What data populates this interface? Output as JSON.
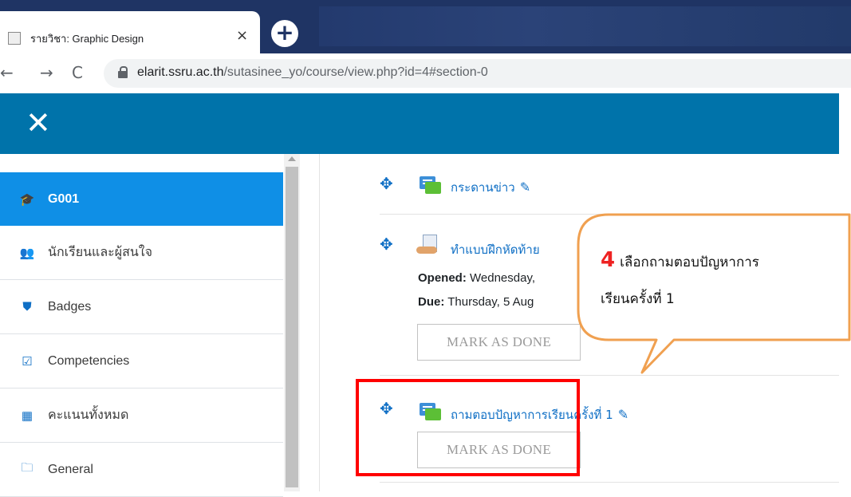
{
  "browser": {
    "tab_title": "รายวิชา: Graphic Design",
    "tab_close": "×",
    "new_tab": "+",
    "url_host": "elarit.ssru.ac.th",
    "url_path": "/sutasinee_yo/course/view.php?id=4#section-0"
  },
  "header": {
    "close_glyph": "✕"
  },
  "sidebar": {
    "items": [
      {
        "label": "G001",
        "icon": "graduation-cap-icon",
        "glyph": "🎓"
      },
      {
        "label": "นักเรียนและผู้สนใจ",
        "icon": "users-icon",
        "glyph": "👥"
      },
      {
        "label": "Badges",
        "icon": "shield-icon",
        "glyph": "⛊"
      },
      {
        "label": "Competencies",
        "icon": "check-square-icon",
        "glyph": "☑"
      },
      {
        "label": "คะแนนทั้งหมด",
        "icon": "table-icon",
        "glyph": "▦"
      },
      {
        "label": "General",
        "icon": "folder-icon",
        "glyph": "🗀"
      }
    ]
  },
  "activities": {
    "news": {
      "title": "กระดานข่าว"
    },
    "quiz": {
      "title": "ทำแบบฝึกหัดท้าย",
      "opened_label": "Opened:",
      "opened_value": " Wednesday,",
      "due_label": "Due:",
      "due_value": " Thursday, 5 Aug",
      "mark_done": "MARK AS DONE"
    },
    "qa": {
      "title": "ถามตอบปัญหาการเรียนครั้งที่ 1",
      "mark_done": "MARK AS DONE"
    }
  },
  "callout": {
    "step_number": "4",
    "line1": "เลือกถามตอบปัญหาการ",
    "line2": "เรียนครั้งที่ 1"
  },
  "colors": {
    "brand_bar": "#0073aa",
    "active_item": "#0f8fe6",
    "highlight": "#ff0000",
    "callout_border": "#f0a050"
  }
}
